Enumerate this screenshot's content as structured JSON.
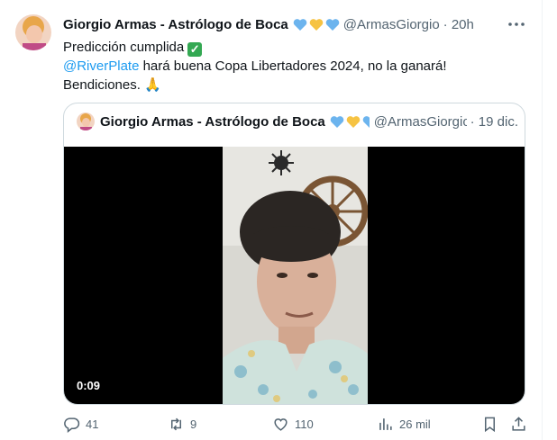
{
  "tweet": {
    "author_name": "Giorgio Armas - Astrólogo de Boca",
    "author_handle": "@ArmasGiorgio",
    "time": "· 20h",
    "line1": "Predicción cumplida",
    "line2_mention": "@RiverPlate",
    "line2_rest": " hará buena Copa Libertadores 2024, no la ganará!",
    "line3": "Bendiciones.",
    "line3_emoji": "🙏"
  },
  "quoted": {
    "author_name": "Giorgio Armas - Astrólogo de Boca",
    "author_handle": "@ArmasGiorgio",
    "date": "· 19 dic.",
    "video_duration": "0:09"
  },
  "actions": {
    "replies": "41",
    "retweets": "9",
    "likes": "110",
    "views": "26 mil"
  },
  "colors": {
    "heart_blue": "#6cb4ee",
    "heart_yellow": "#f6c343",
    "accent": "#1d9bf0",
    "muted": "#536471"
  }
}
